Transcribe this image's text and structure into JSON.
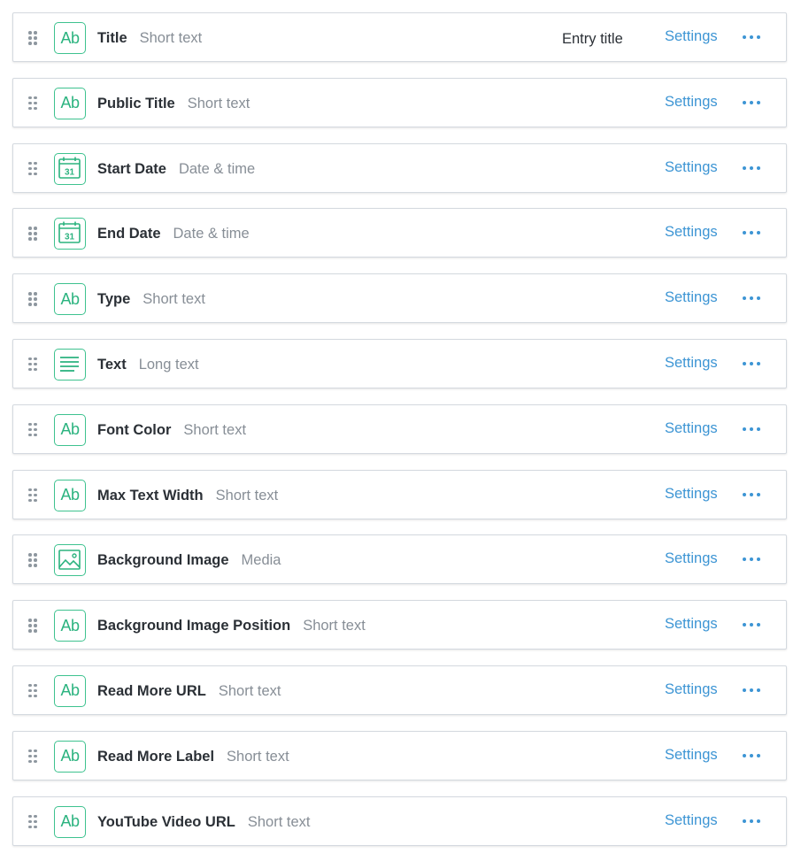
{
  "fields": [
    {
      "name": "Title",
      "type": "Short text",
      "icon": "text-ab-icon",
      "entry_title": "Entry title",
      "settings_label": "Settings"
    },
    {
      "name": "Public Title",
      "type": "Short text",
      "icon": "text-ab-icon",
      "settings_label": "Settings"
    },
    {
      "name": "Start Date",
      "type": "Date & time",
      "icon": "calendar-icon",
      "icon_text": "31",
      "settings_label": "Settings"
    },
    {
      "name": "End Date",
      "type": "Date & time",
      "icon": "calendar-icon",
      "icon_text": "31",
      "settings_label": "Settings"
    },
    {
      "name": "Type",
      "type": "Short text",
      "icon": "text-ab-icon",
      "settings_label": "Settings"
    },
    {
      "name": "Text",
      "type": "Long text",
      "icon": "long-text-icon",
      "settings_label": "Settings"
    },
    {
      "name": "Font Color",
      "type": "Short text",
      "icon": "text-ab-icon",
      "settings_label": "Settings"
    },
    {
      "name": "Max Text Width",
      "type": "Short text",
      "icon": "text-ab-icon",
      "settings_label": "Settings"
    },
    {
      "name": "Background Image",
      "type": "Media",
      "icon": "media-image-icon",
      "settings_label": "Settings"
    },
    {
      "name": "Background Image Position",
      "type": "Short text",
      "icon": "text-ab-icon",
      "settings_label": "Settings"
    },
    {
      "name": "Read More URL",
      "type": "Short text",
      "icon": "text-ab-icon",
      "settings_label": "Settings"
    },
    {
      "name": "Read More Label",
      "type": "Short text",
      "icon": "text-ab-icon",
      "settings_label": "Settings"
    },
    {
      "name": "YouTube Video URL",
      "type": "Short text",
      "icon": "text-ab-icon",
      "settings_label": "Settings"
    }
  ],
  "icon_ab_text": "Ab",
  "colors": {
    "accent_green": "#3ec28f",
    "link_blue": "#3d95d4",
    "text_dark": "#2b3036",
    "text_muted": "#878e96",
    "border": "#d4d9df"
  }
}
